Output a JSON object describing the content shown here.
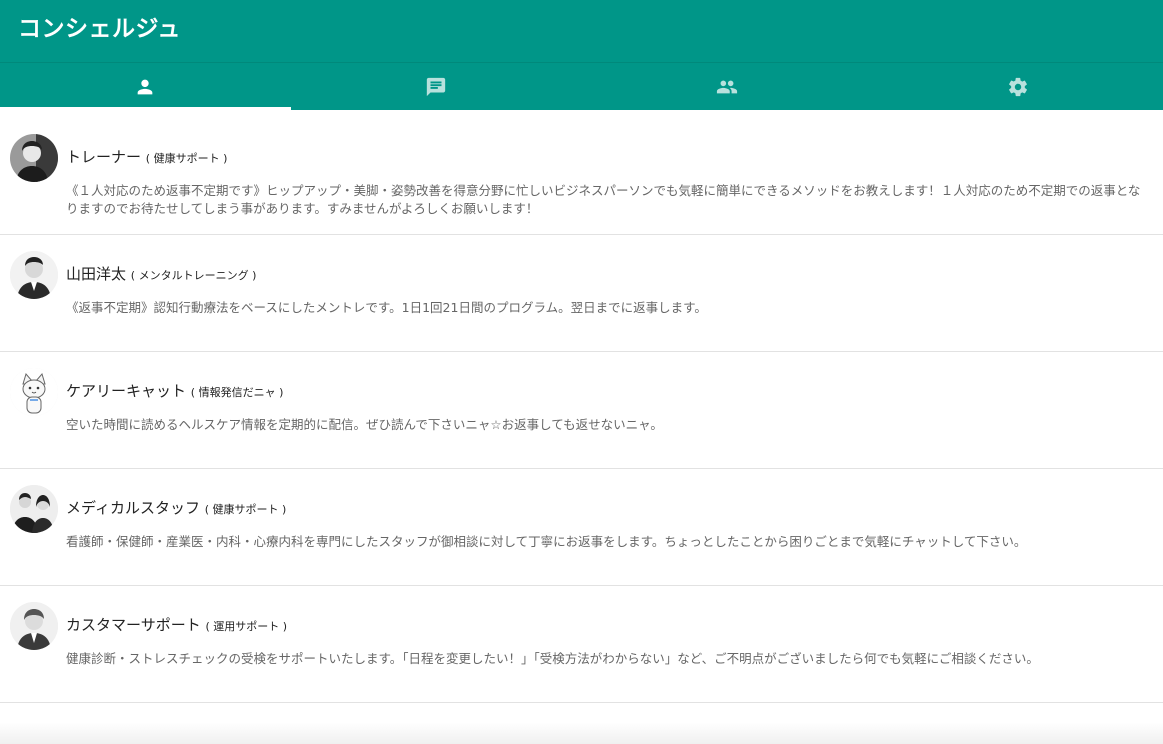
{
  "app": {
    "title": "コンシェルジュ"
  },
  "tabs": [
    {
      "icon": "person-icon",
      "active": true
    },
    {
      "icon": "chat-icon",
      "active": false
    },
    {
      "icon": "people-icon",
      "active": false
    },
    {
      "icon": "gear-icon",
      "active": false
    }
  ],
  "colors": {
    "primary": "#009688",
    "indicator": "#ffffff",
    "divider": "#e2e2e2",
    "description": "#666666"
  },
  "concierges": [
    {
      "name": "トレーナー",
      "category": "( 健康サポート )",
      "description": "《１人対応のため返事不定期です》ヒップアップ・美脚・姿勢改善を得意分野に忙しいビジネスパーソンでも気軽に簡単にできるメソッドをお教えします！１人対応のため不定期での返事となりますのでお待たせしてしまう事があります。すみませんがよろしくお願いします！",
      "avatar": "trainer-avatar"
    },
    {
      "name": "山田洋太",
      "category": "( メンタルトレーニング )",
      "description": "《返事不定期》認知行動療法をベースにしたメントレです。1日1回21日間のプログラム。翌日までに返事します。",
      "avatar": "yamada-avatar"
    },
    {
      "name": "ケアリーキャット",
      "category": "( 情報発信だニャ )",
      "description": "空いた時間に読めるヘルスケア情報を定期的に配信。ぜひ読んで下さいニャ☆お返事しても返せないニャ。",
      "avatar": "cat-avatar"
    },
    {
      "name": "メディカルスタッフ",
      "category": "( 健康サポート )",
      "description": "看護師・保健師・産業医・内科・心療内科を専門にしたスタッフが御相談に対して丁寧にお返事をします。ちょっとしたことから困りごとまで気軽にチャットして下さい。",
      "avatar": "medical-staff-avatar"
    },
    {
      "name": "カスタマーサポート",
      "category": "( 運用サポート )",
      "description": "健康診断・ストレスチェックの受検をサポートいたします。「日程を変更したい！」「受検方法がわからない」など、ご不明点がございましたら何でも気軽にご相談ください。",
      "avatar": "support-avatar"
    }
  ]
}
